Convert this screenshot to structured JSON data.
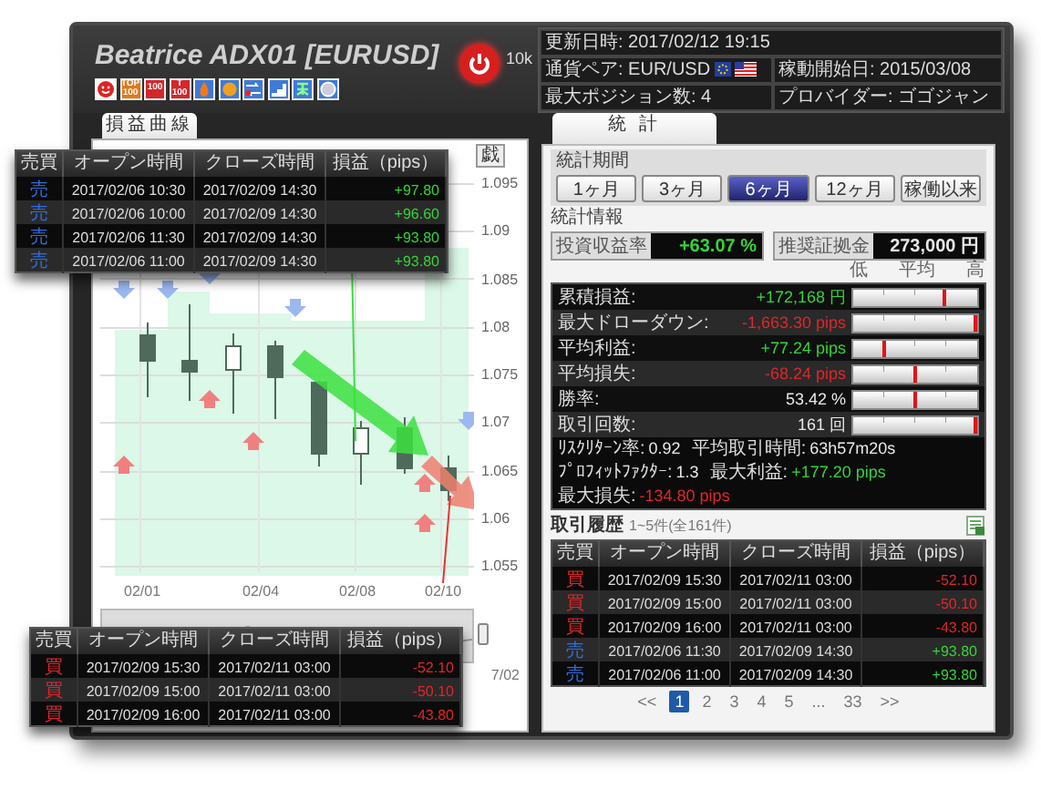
{
  "header": {
    "title": "Beatrice ADX01 [EURUSD]",
    "badges": [
      {
        "kind": "smiley"
      },
      {
        "kind": "text",
        "color": "#e07a1a",
        "lines": [
          "TOP",
          "100"
        ]
      },
      {
        "kind": "text",
        "color": "#d3272b",
        "lines": [
          "100"
        ]
      },
      {
        "kind": "text",
        "color": "#d3272b",
        "lines": [
          "T",
          "100"
        ]
      },
      {
        "kind": "flame"
      },
      {
        "kind": "ball"
      },
      {
        "kind": "swap"
      },
      {
        "kind": "stairs"
      },
      {
        "kind": "figure"
      },
      {
        "kind": "globe"
      }
    ],
    "power": {
      "on": true
    },
    "capital": "10k",
    "info": {
      "updated": "更新日時: 2017/02/12 19:15",
      "pair": "通貨ペア: EUR/USD",
      "start": "稼動開始日: 2015/03/08",
      "max_positions": "最大ポジション数: 4",
      "provider": "プロバイダー: ゴゴジャン"
    }
  },
  "left_panel": {
    "tab": {
      "label": "損益曲線",
      "selected": true
    },
    "range_button": "戯",
    "chart": {
      "yticks": [
        "1.095",
        "1.09",
        "1.085",
        "1.08",
        "1.075",
        "1.07",
        "1.065",
        "1.06",
        "1.055"
      ],
      "xticks": [
        "02/01",
        "02/04",
        "02/08",
        "02/10"
      ],
      "navigator_label": "7/02"
    }
  },
  "popups": [
    {
      "columns": [
        "売買",
        "オープン時間",
        "クローズ時間",
        "損益（pips）"
      ],
      "rows": [
        {
          "side": "売",
          "kind": "sell",
          "open": "2017/02/06 10:30",
          "close": "2017/02/09 14:30",
          "pips": "+97.80",
          "gain": true
        },
        {
          "side": "売",
          "kind": "sell",
          "open": "2017/02/06 10:00",
          "close": "2017/02/09 14:30",
          "pips": "+96.60",
          "gain": true
        },
        {
          "side": "売",
          "kind": "sell",
          "open": "2017/02/06 11:30",
          "close": "2017/02/09 14:30",
          "pips": "+93.80",
          "gain": true
        },
        {
          "side": "売",
          "kind": "sell",
          "open": "2017/02/06 11:00",
          "close": "2017/02/09 14:30",
          "pips": "+93.80",
          "gain": true
        }
      ]
    },
    {
      "columns": [
        "売買",
        "オープン時間",
        "クローズ時間",
        "損益（pips）"
      ],
      "rows": [
        {
          "side": "買",
          "kind": "buy",
          "open": "2017/02/09 15:30",
          "close": "2017/02/11 03:00",
          "pips": "-52.10",
          "gain": false
        },
        {
          "side": "買",
          "kind": "buy",
          "open": "2017/02/09 15:00",
          "close": "2017/02/11 03:00",
          "pips": "-50.10",
          "gain": false
        },
        {
          "side": "買",
          "kind": "buy",
          "open": "2017/02/09 16:00",
          "close": "2017/02/11 03:00",
          "pips": "-43.80",
          "gain": false
        }
      ]
    }
  ],
  "right_panel": {
    "tab": {
      "label": "統 計",
      "selected": true
    },
    "period": {
      "title": "統計期間",
      "buttons": [
        {
          "label": "1ヶ月",
          "selected": false
        },
        {
          "label": "3ヶ月",
          "selected": false
        },
        {
          "label": "6ヶ月",
          "selected": true
        },
        {
          "label": "12ヶ月",
          "selected": false
        },
        {
          "label": "稼働以来",
          "selected": false
        }
      ]
    },
    "info_title": "統計情報",
    "summary": [
      {
        "label": "投資収益率",
        "value": "+63.07 %",
        "kind": "gain"
      },
      {
        "label": "推奨証拠金",
        "value": "273,000 円",
        "kind": "neutral"
      }
    ],
    "scale": [
      "低",
      "平均",
      "高"
    ],
    "metrics": [
      {
        "label": "累積損益:",
        "value": "+172,168 円",
        "kind": "gain",
        "level": 0.74
      },
      {
        "label": "最大ドローダウン:",
        "value": "-1,663.30 pips",
        "kind": "loss",
        "level": 0.98
      },
      {
        "label": "平均利益:",
        "value": "+77.24 pips",
        "kind": "gain",
        "level": 0.25
      },
      {
        "label": "平均損失:",
        "value": "-68.24 pips",
        "kind": "loss",
        "level": 0.5
      },
      {
        "label": "勝率:",
        "value": "53.42 %",
        "kind": "neutral",
        "level": 0.5
      },
      {
        "label": "取引回数:",
        "value": "161 回",
        "kind": "neutral",
        "level": 0.98
      }
    ],
    "extra_lines": [
      [
        {
          "label": "ﾘｽｸﾘﾀｰﾝ率:",
          "value": "0.92",
          "kind": "neutral"
        },
        {
          "label": "平均取引時間:",
          "value": "63h57m20s",
          "kind": "neutral"
        }
      ],
      [
        {
          "label": "ﾌﾟﾛﾌｨｯﾄﾌｧｸﾀｰ:",
          "value": "1.3",
          "kind": "neutral"
        },
        {
          "label": "最大利益:",
          "value": "+177.20 pips",
          "kind": "gain"
        },
        {
          "label": "最大損失:",
          "value": "-134.80 pips",
          "kind": "loss"
        }
      ]
    ],
    "history": {
      "title": "取引履歴",
      "count": "1~5件(全161件)",
      "columns": [
        "売買",
        "オープン時間",
        "クローズ時間",
        "損益（pips）"
      ],
      "rows": [
        {
          "side": "買",
          "kind": "buy",
          "open": "2017/02/09 15:30",
          "close": "2017/02/11 03:00",
          "pips": "-52.10",
          "gain": false
        },
        {
          "side": "買",
          "kind": "buy",
          "open": "2017/02/09 15:00",
          "close": "2017/02/11 03:00",
          "pips": "-50.10",
          "gain": false
        },
        {
          "side": "買",
          "kind": "buy",
          "open": "2017/02/09 16:00",
          "close": "2017/02/11 03:00",
          "pips": "-43.80",
          "gain": false
        },
        {
          "side": "売",
          "kind": "sell",
          "open": "2017/02/06 11:30",
          "close": "2017/02/09 14:30",
          "pips": "+93.80",
          "gain": true
        },
        {
          "side": "売",
          "kind": "sell",
          "open": "2017/02/06 11:00",
          "close": "2017/02/09 14:30",
          "pips": "+93.80",
          "gain": true
        }
      ]
    },
    "pagination": [
      {
        "label": "<<",
        "selected": false
      },
      {
        "label": "1",
        "selected": true
      },
      {
        "label": "2",
        "selected": false
      },
      {
        "label": "3",
        "selected": false
      },
      {
        "label": "4",
        "selected": false
      },
      {
        "label": "5",
        "selected": false
      },
      {
        "label": "...",
        "selected": false
      },
      {
        "label": "33",
        "selected": false
      },
      {
        "label": ">>",
        "selected": false
      }
    ]
  }
}
